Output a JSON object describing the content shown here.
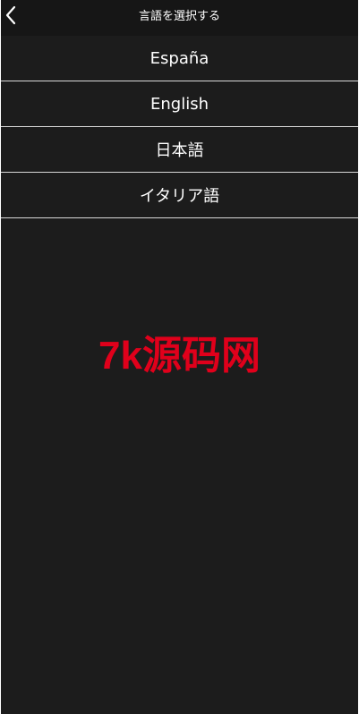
{
  "header": {
    "title": "言語を選択する",
    "back_icon": "chevron-left-icon"
  },
  "languages": [
    {
      "label": "España"
    },
    {
      "label": "English"
    },
    {
      "label": "日本語"
    },
    {
      "label": "イタリア語"
    }
  ],
  "watermark": {
    "text": "7k源码网",
    "color": "#e0001b"
  },
  "colors": {
    "background": "#1c1c1c",
    "header_background": "#161616",
    "divider": "#d9d9d9",
    "text": "#ffffff"
  }
}
